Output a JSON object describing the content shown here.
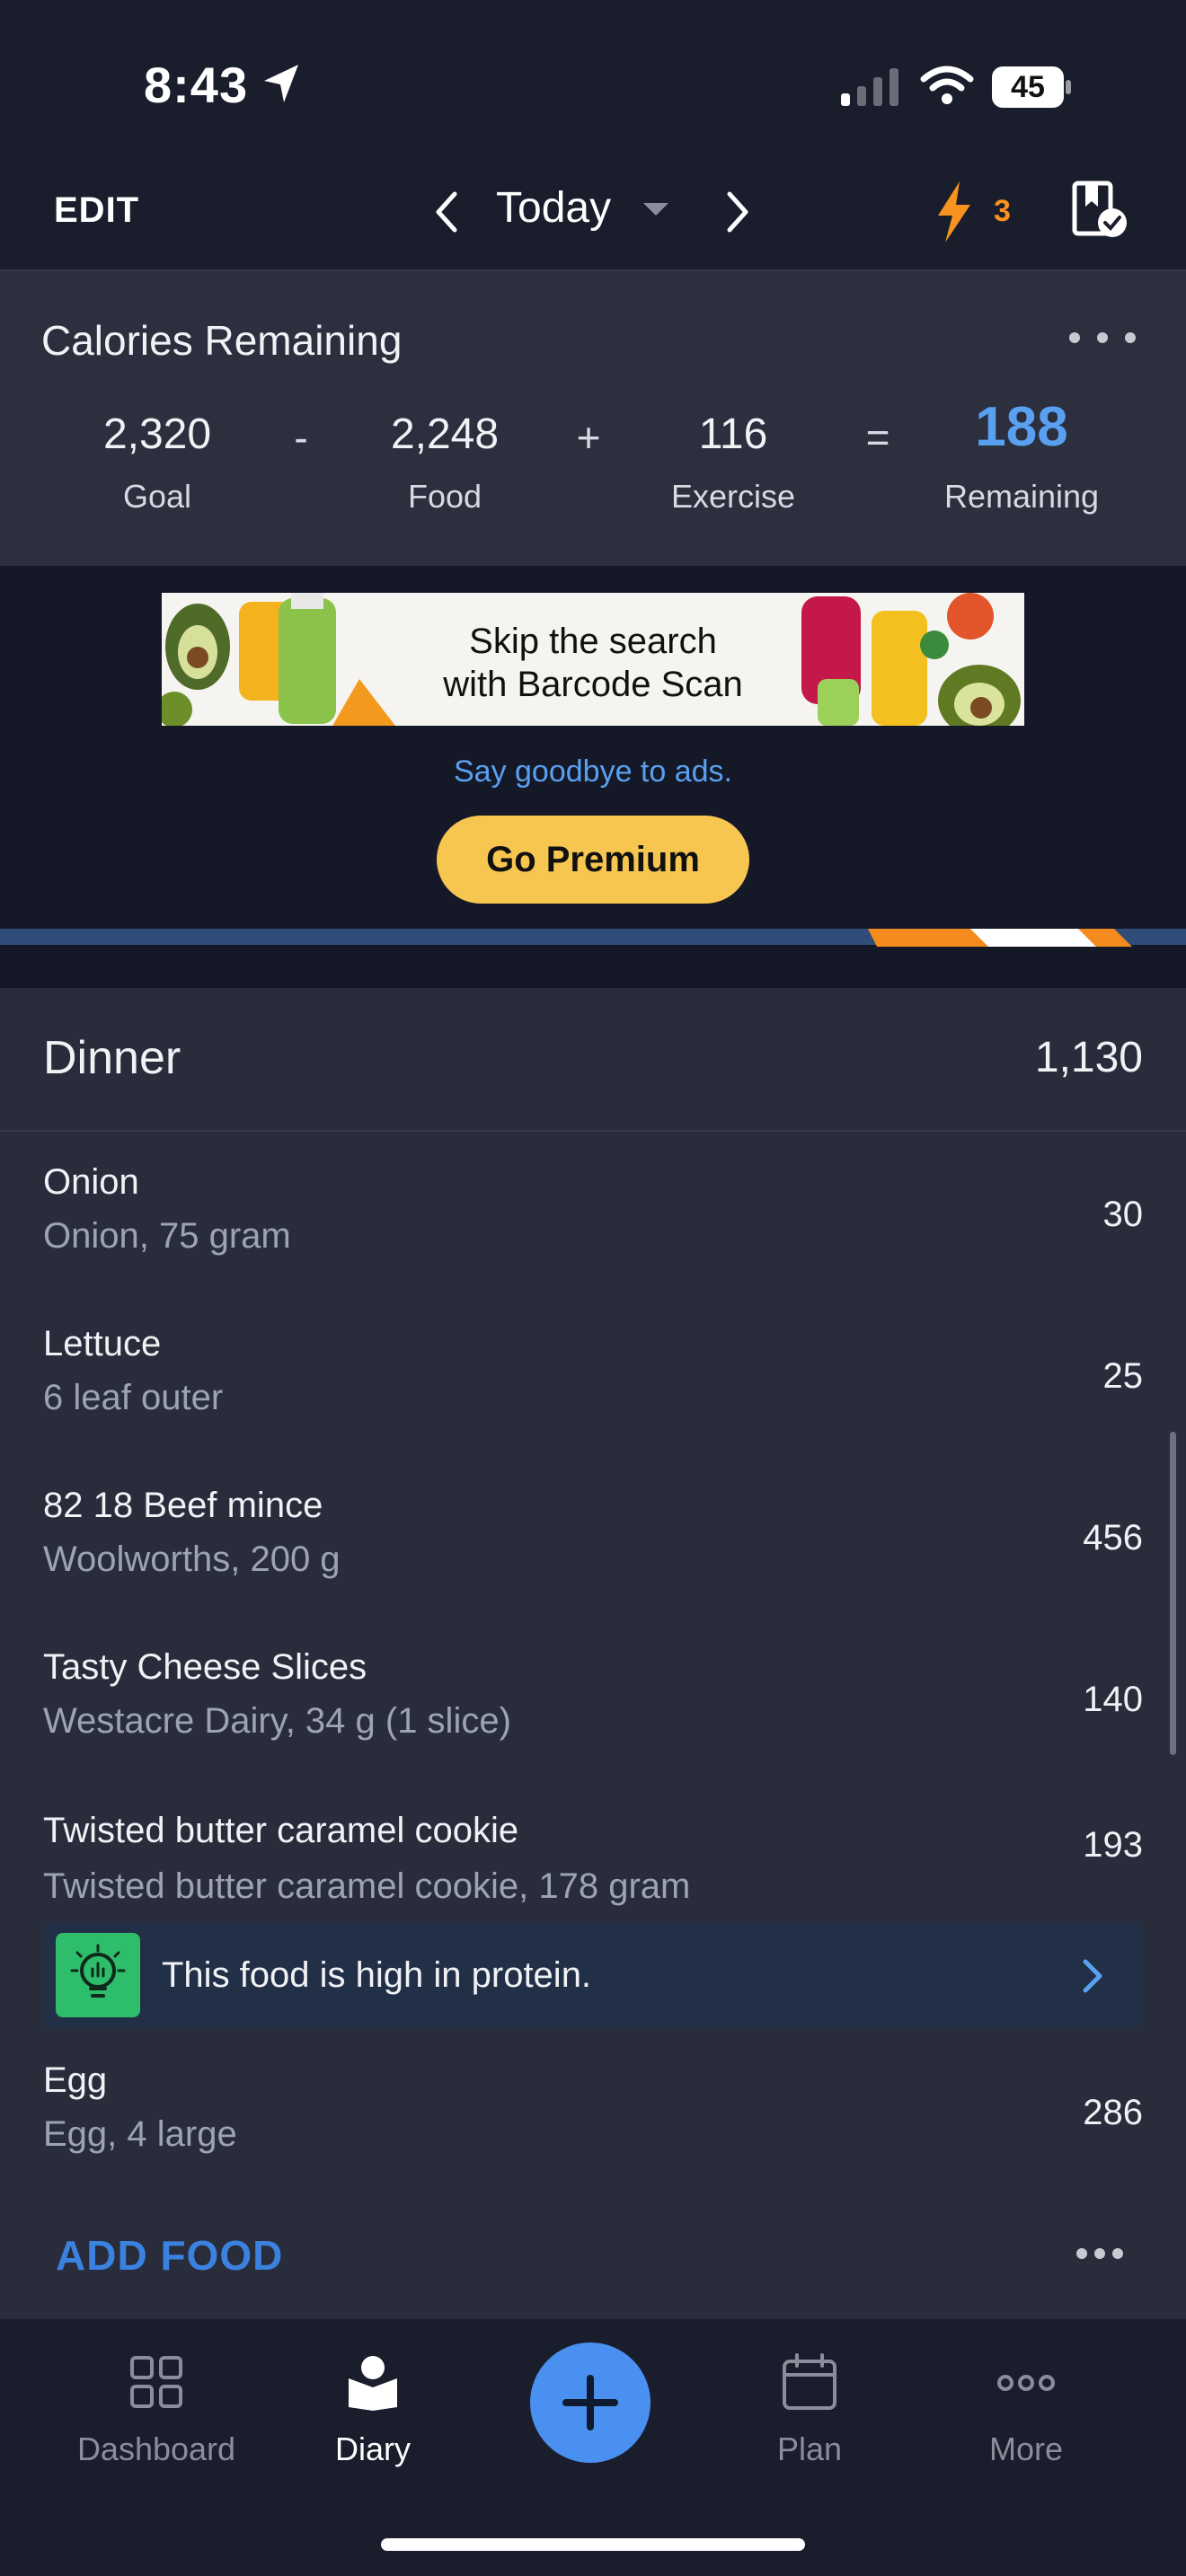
{
  "status_bar": {
    "time": "8:43",
    "battery": "45"
  },
  "header": {
    "edit_label": "EDIT",
    "date_label": "Today",
    "streak_count": "3"
  },
  "calories": {
    "title": "Calories Remaining",
    "goal": {
      "value": "2,320",
      "label": "Goal"
    },
    "food": {
      "value": "2,248",
      "label": "Food"
    },
    "exercise": {
      "value": "116",
      "label": "Exercise"
    },
    "remaining": {
      "value": "188",
      "label": "Remaining"
    },
    "ops": {
      "minus": "-",
      "plus": "+",
      "equals": "="
    }
  },
  "ad": {
    "banner_line1": "Skip the search",
    "banner_line2": "with Barcode Scan",
    "goodbye": "Say goodbye to ads.",
    "premium_label": "Go Premium"
  },
  "dinner": {
    "title": "Dinner",
    "total": "1,130",
    "items": [
      {
        "name": "Onion",
        "desc": "Onion, 75 gram",
        "cal": "30"
      },
      {
        "name": "Lettuce",
        "desc": "6 leaf outer",
        "cal": "25"
      },
      {
        "name": "82 18 Beef mince",
        "desc": "Woolworths, 200 g",
        "cal": "456"
      },
      {
        "name": "Tasty Cheese Slices",
        "desc": "Westacre Dairy, 34 g (1 slice)",
        "cal": "140"
      },
      {
        "name": "Twisted butter caramel cookie",
        "desc": "Twisted butter caramel cookie, 178 gram",
        "cal": "193"
      },
      {
        "name": "Egg",
        "desc": "Egg, 4 large",
        "cal": "286"
      }
    ],
    "insight": "This food is high in protein.",
    "add_food": "ADD FOOD"
  },
  "tabs": [
    {
      "label": "Dashboard",
      "icon": "dashboard-icon"
    },
    {
      "label": "Diary",
      "icon": "diary-icon",
      "active": true
    },
    {
      "label": "Plan",
      "icon": "calendar-icon"
    },
    {
      "label": "More",
      "icon": "more-icon"
    }
  ],
  "colors": {
    "accent": "#4a90f0",
    "remaining": "#5aa0f0",
    "premium": "#f7c650",
    "streak": "#f7931e",
    "insight_icon": "#2ebd6b"
  }
}
